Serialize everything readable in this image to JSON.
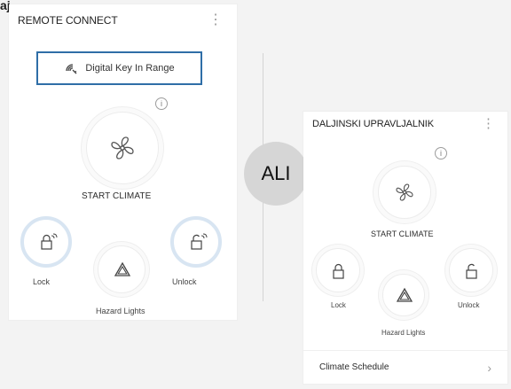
{
  "top_fragment": "aj",
  "left_panel": {
    "title": "REMOTE CONNECT",
    "menu": "⋮",
    "digital_key": "Digital Key In Range",
    "climate_label": "START CLIMATE",
    "lock_label": "Lock",
    "hazard_label": "Hazard Lights",
    "unlock_label": "Unlock"
  },
  "separator_label": "ALI",
  "right_panel": {
    "title": "DALJINSKI UPRAVLJALNIK",
    "menu": "⋮",
    "climate_label": "START CLIMATE",
    "lock_label": "Lock",
    "hazard_label": "Hazard Lights",
    "unlock_label": "Unlock",
    "schedule_label": "Climate Schedule",
    "schedule_chevron": "›"
  },
  "info_glyph": "i",
  "accent_color": "#2f6ea7",
  "halo_color": "#d8e5f2",
  "badge_color": "#d6d6d6",
  "icons": [
    "digital-key-icon",
    "info-icon",
    "fan-icon",
    "lock-icon",
    "hazard-icon",
    "unlock-icon",
    "chevron-right-icon"
  ]
}
